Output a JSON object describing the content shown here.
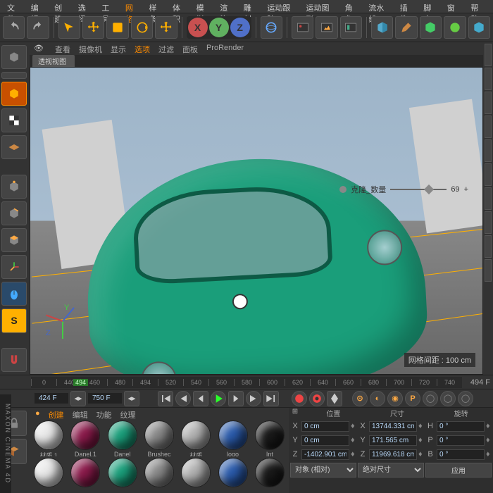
{
  "menu": [
    "文件",
    "编辑",
    "创建",
    "选择",
    "工具",
    "网格",
    "样条",
    "体积",
    "模拟",
    "渲染",
    "雕刻",
    "运动跟踪",
    "运动图形",
    "角色",
    "流水线",
    "插件",
    "脚本",
    "窗口",
    "帮助"
  ],
  "menu_hot_index": 5,
  "view_menu": [
    "查看",
    "摄像机",
    "显示",
    "选项",
    "过滤",
    "面板",
    "ProRender"
  ],
  "view_menu_active": 3,
  "view_tab": "透视视图",
  "overlay": {
    "slider_label": "克隆_数量",
    "slider_value": "69",
    "grid_label": "网格间距 : 100 cm"
  },
  "timeline": {
    "ticks": [
      "0",
      "440",
      "460",
      "480",
      "494",
      "520",
      "540",
      "560",
      "580",
      "600",
      "620",
      "640",
      "660",
      "680",
      "700",
      "720",
      "740"
    ],
    "current": "494",
    "right_label": "494 F"
  },
  "playback": {
    "start": "424 F",
    "end": "750 F"
  },
  "mat_tabs": [
    "创建",
    "编辑",
    "功能",
    "纹理"
  ],
  "materials": [
    {
      "name": "材质.1",
      "color": "#e8e8e8"
    },
    {
      "name": "Danel.1",
      "color": "#8a1a4a"
    },
    {
      "name": "Danel",
      "color": "#1a9e7a"
    },
    {
      "name": "Brushec",
      "color": "#888"
    },
    {
      "name": "材质",
      "color": "#b0b0b0"
    },
    {
      "name": "logo",
      "color": "#2a5aaa"
    },
    {
      "name": "Int",
      "color": "#1a1a1a"
    }
  ],
  "coord_head": [
    "位置",
    "尺寸",
    "旋转"
  ],
  "coords": {
    "X": {
      "pos": "0 cm",
      "size": "13744.331 cm",
      "rot_lbl": "H",
      "rot": "0 °"
    },
    "Y": {
      "pos": "0 cm",
      "size": "171.565 cm",
      "rot_lbl": "P",
      "rot": "0 °"
    },
    "Z": {
      "pos": "-1402.901 cm",
      "size": "11969.618 cm",
      "rot_lbl": "B",
      "rot": "0 °"
    }
  },
  "coord_foot": {
    "mode": "对象 (相对)",
    "size_mode": "绝对尺寸",
    "apply": "应用"
  },
  "brand": "MAXON CINEMA 4D"
}
